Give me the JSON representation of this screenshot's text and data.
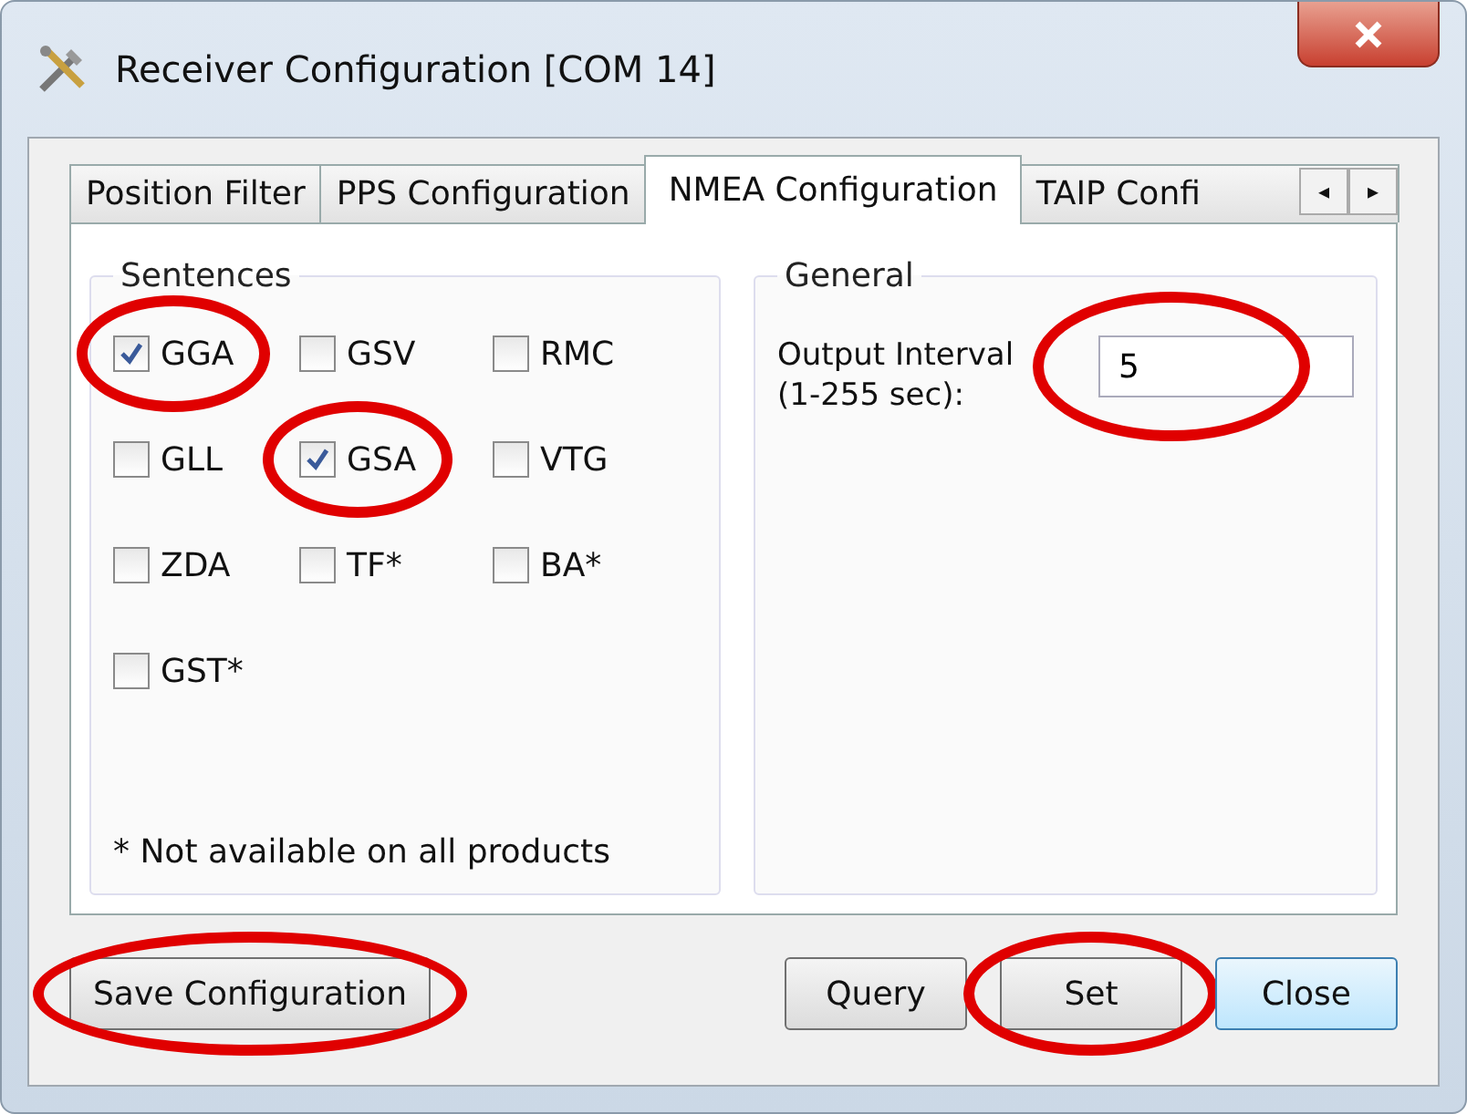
{
  "window": {
    "title": "Receiver Configuration [COM 14]"
  },
  "tabs": [
    {
      "label": "Position Filter",
      "selected": false
    },
    {
      "label": "PPS Configuration",
      "selected": false
    },
    {
      "label": "NMEA Configuration",
      "selected": true
    },
    {
      "label": "TAIP Confi",
      "selected": false
    }
  ],
  "tab_scroll": [
    "◂",
    "▸"
  ],
  "sentences": {
    "title": "Sentences",
    "items": [
      {
        "label": "GGA",
        "checked": true,
        "circled": true
      },
      {
        "label": "GSV",
        "checked": false,
        "circled": false
      },
      {
        "label": "RMC",
        "checked": false,
        "circled": false
      },
      {
        "label": "GLL",
        "checked": false,
        "circled": false
      },
      {
        "label": "GSA",
        "checked": true,
        "circled": true
      },
      {
        "label": "VTG",
        "checked": false,
        "circled": false
      },
      {
        "label": "ZDA",
        "checked": false,
        "circled": false
      },
      {
        "label": "TF*",
        "checked": false,
        "circled": false
      },
      {
        "label": "BA*",
        "checked": false,
        "circled": false
      },
      {
        "label": "GST*",
        "checked": false,
        "circled": false
      }
    ],
    "footnote": "* Not available on all products"
  },
  "general": {
    "title": "General",
    "output_interval": {
      "label": "Output Interval (1-255 sec):",
      "value": "5",
      "circled": true
    }
  },
  "buttons": [
    {
      "label": "Save Configuration",
      "kind": "left",
      "circled": true
    },
    {
      "label": "Query",
      "kind": "right",
      "circled": false
    },
    {
      "label": "Set",
      "kind": "right",
      "circled": true
    },
    {
      "label": "Close",
      "kind": "default",
      "circled": false
    }
  ]
}
